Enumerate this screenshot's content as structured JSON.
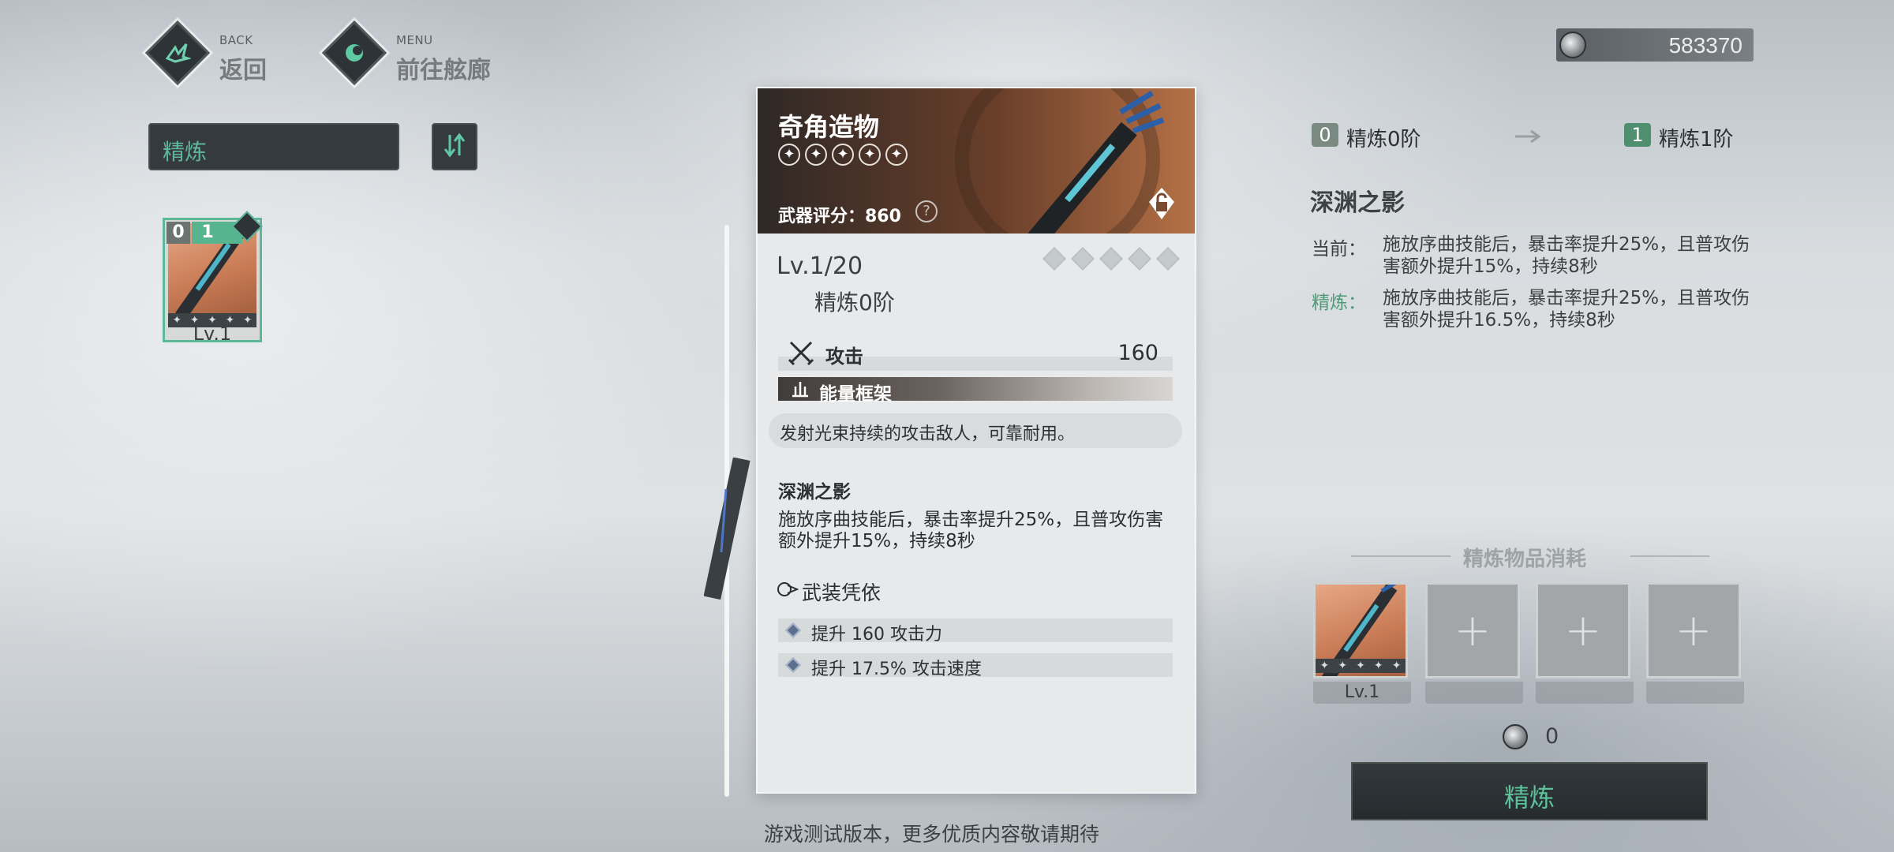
{
  "nav": {
    "back_small": "BACK",
    "back_label": "返回",
    "menu_small": "MENU",
    "menu_label": "前往舷廊"
  },
  "currency": {
    "icon": "coin-icon",
    "value": "583370"
  },
  "filter": {
    "label": "精炼",
    "sort_icon": "sort-icon"
  },
  "inventory": [
    {
      "refine_current": "0",
      "refine_next": "1",
      "level": "Lv.1",
      "selected": true
    }
  ],
  "weapon": {
    "name": "奇角造物",
    "rarity_stars": 5,
    "score_label": "武器评分：860",
    "level": "Lv.1/20",
    "refine": "精炼0阶",
    "stat_label": "攻击",
    "stat_value": "160",
    "type": "能量框架",
    "description": "发射光束持续的攻击敌人，可靠耐用。",
    "skill_title": "深渊之影",
    "skill_desc": "施放序曲技能后，暴击率提升25%，且普攻伤害额外提升15%，持续8秒",
    "armament_title": "武装凭依",
    "armament_bonuses": [
      "提升 160 攻击力",
      "提升 17.5% 攻击速度"
    ]
  },
  "refine_panel": {
    "from_level": "0",
    "from_label": "精炼0阶",
    "to_level": "1",
    "to_label": "精炼1阶",
    "skill_title": "深渊之影",
    "current_label": "当前：",
    "current_text": "施放序曲技能后，暴击率提升25%，且普攻伤害额外提升15%，持续8秒",
    "refine_label": "精炼：",
    "refine_text": "施放序曲技能后，暴击率提升25%，且普攻伤害额外提升16.5%，持续8秒",
    "consume_title": "精炼物品消耗",
    "slot1_level": "Lv.1",
    "cost": "0",
    "button_label": "精炼"
  },
  "footer": "游戏测试版本，更多优质内容敬请期待",
  "colors": {
    "accent": "#5cb897",
    "panel_dark": "#353a3e"
  }
}
